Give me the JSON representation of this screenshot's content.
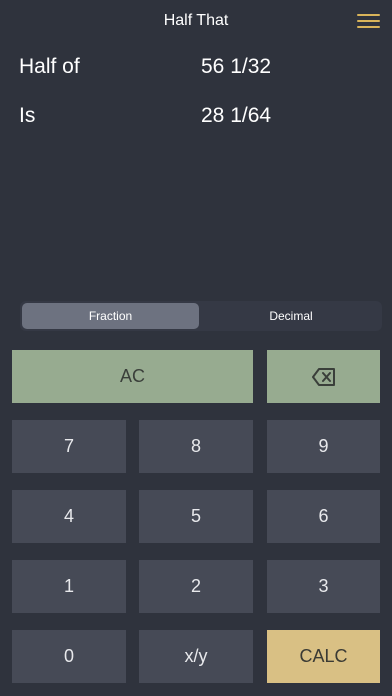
{
  "header": {
    "title": "Half That",
    "menu_icon": "hamburger-menu-icon",
    "menu_color": "#d9b45a"
  },
  "result": {
    "half_of_label": "Half of",
    "half_of_value": "56 1/32",
    "is_label": "Is",
    "is_value": "28 1/64"
  },
  "mode": {
    "options": [
      "Fraction",
      "Decimal"
    ],
    "selected": "Fraction"
  },
  "keypad": {
    "ac": "AC",
    "backspace_icon": "backspace-icon",
    "k7": "7",
    "k8": "8",
    "k9": "9",
    "k4": "4",
    "k5": "5",
    "k6": "6",
    "k1": "1",
    "k2": "2",
    "k3": "3",
    "k0": "0",
    "fraction": "x/y",
    "calc": "CALC"
  },
  "colors": {
    "background": "#2f333d",
    "key": "#464a56",
    "clear": "#97ab90",
    "calc": "#d9c084"
  }
}
